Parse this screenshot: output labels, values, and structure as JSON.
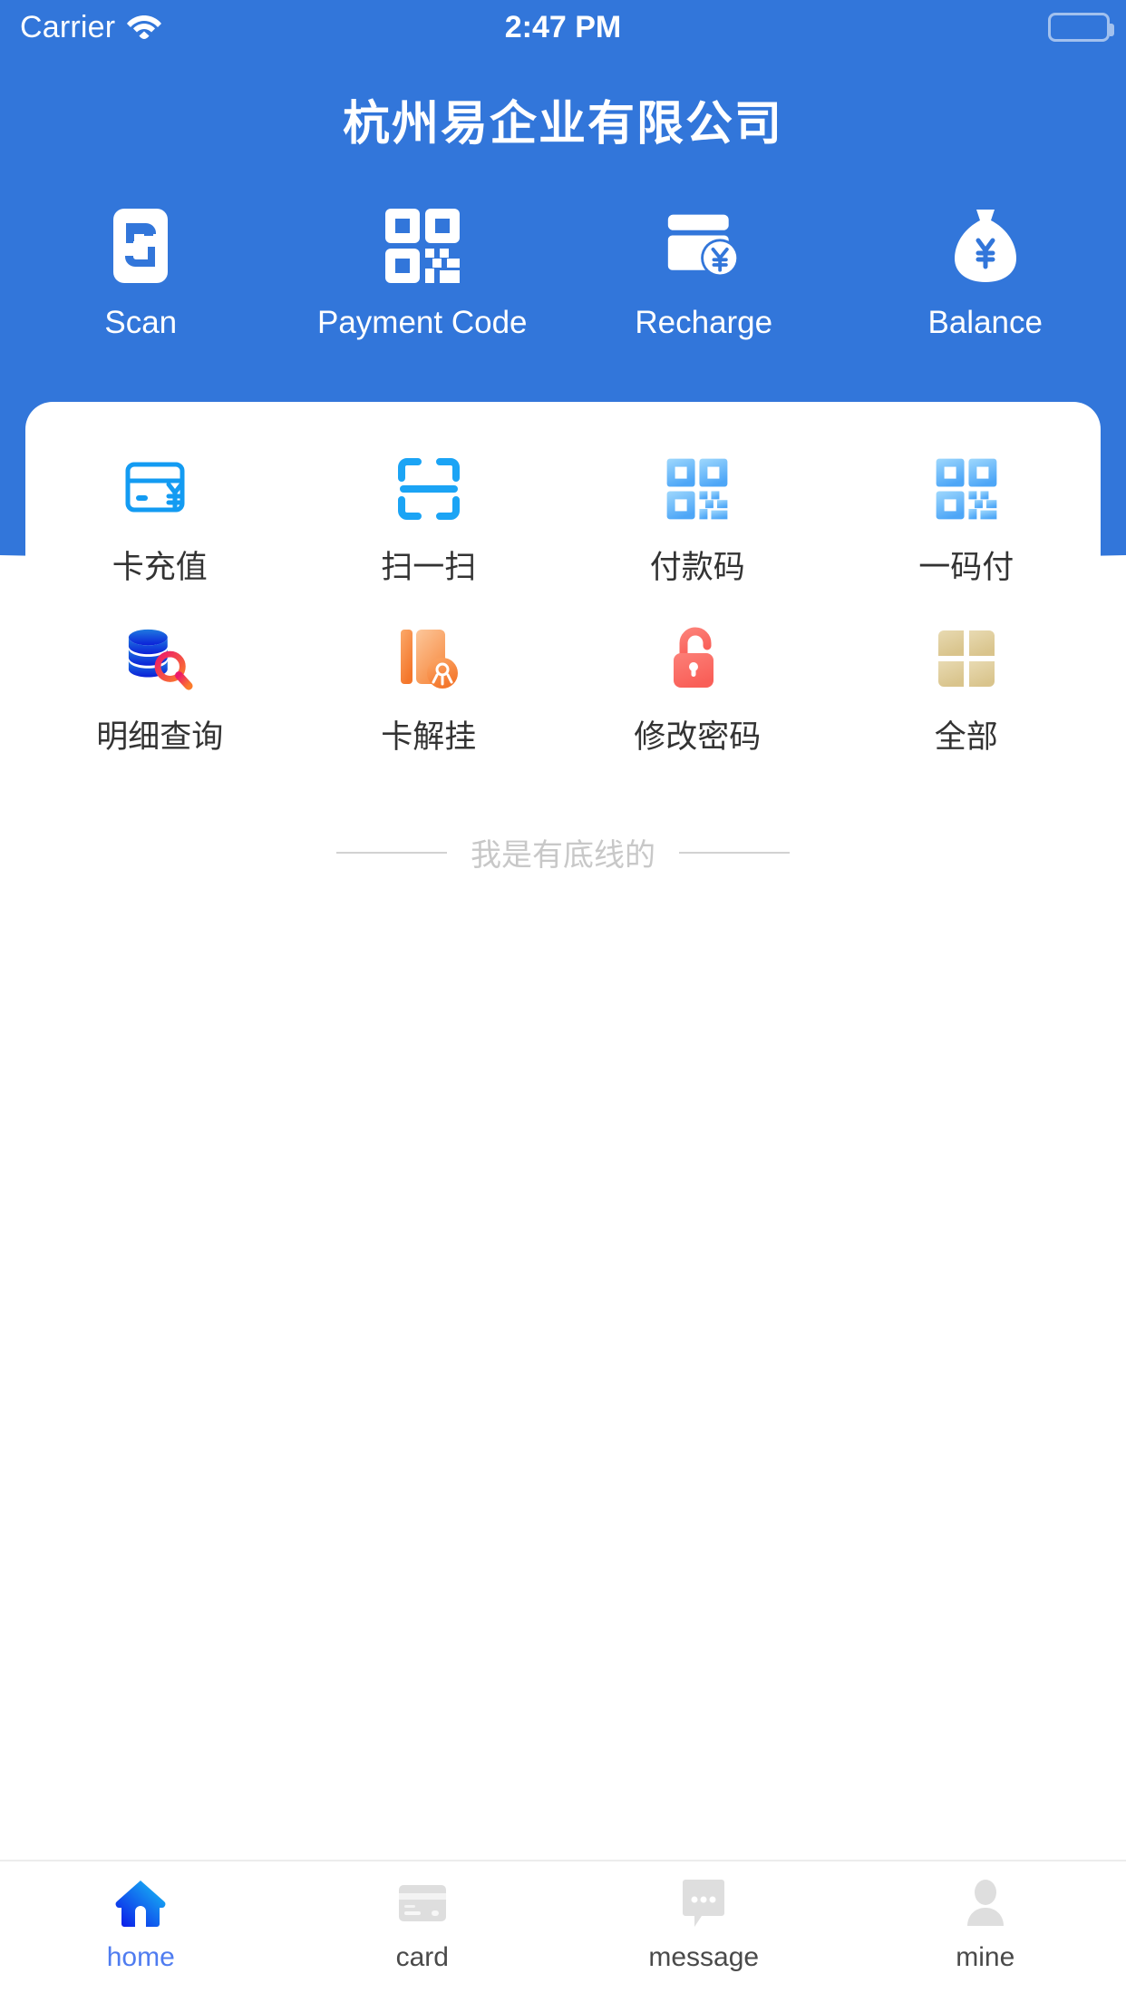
{
  "status_bar": {
    "carrier": "Carrier",
    "wifi_icon": "wifi-icon",
    "time": "2:47 PM",
    "battery_icon": "battery-icon"
  },
  "header": {
    "title": "杭州易企业有限公司",
    "background_color": "#3276da",
    "quick_actions": [
      {
        "label": "Scan",
        "icon": "scan-exchange-icon"
      },
      {
        "label": "Payment Code",
        "icon": "qr-code-icon"
      },
      {
        "label": "Recharge",
        "icon": "card-yuan-icon"
      },
      {
        "label": "Balance",
        "icon": "money-bag-yuan-icon"
      }
    ]
  },
  "grid": {
    "rows": [
      [
        {
          "label": "卡充值",
          "icon": "credit-card-yuan-icon",
          "color": "#2196f3"
        },
        {
          "label": "扫一扫",
          "icon": "scan-frame-icon",
          "color": "#29a8f5"
        },
        {
          "label": "付款码",
          "icon": "qr-code-icon",
          "color": "#5ec2fb"
        },
        {
          "label": "一码付",
          "icon": "qr-code-icon",
          "color": "#5ec2fb"
        }
      ],
      [
        {
          "label": "明细查询",
          "icon": "database-search-icon",
          "color": "#1b4fe0"
        },
        {
          "label": "卡解挂",
          "icon": "card-unlock-orange-icon",
          "color": "#f5853f"
        },
        {
          "label": "修改密码",
          "icon": "unlocked-padlock-icon",
          "color": "#fa6b65"
        },
        {
          "label": "全部",
          "icon": "grid-four-squares-icon",
          "color": "#ddc89a"
        }
      ]
    ]
  },
  "bottom_line": {
    "text": "我是有底线的",
    "color": "#c8c8c8"
  },
  "tabbar": {
    "active_color": "#4f7cf0",
    "inactive_color": "#d8d8d8",
    "items": [
      {
        "label": "home",
        "icon": "home-icon",
        "active": true
      },
      {
        "label": "card",
        "icon": "card-icon",
        "active": false
      },
      {
        "label": "message",
        "icon": "message-bubble-icon",
        "active": false
      },
      {
        "label": "mine",
        "icon": "person-icon",
        "active": false
      }
    ]
  }
}
